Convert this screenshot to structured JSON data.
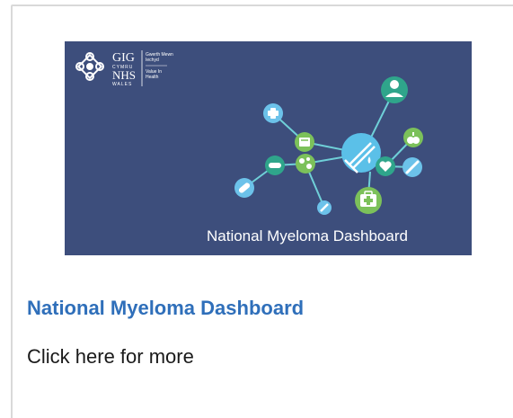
{
  "card": {
    "image": {
      "logo": {
        "gig": "GIG",
        "cymru": "CYMRU",
        "nhs": "NHS",
        "wales": "WALES",
        "line1": "Gwerth Mewn",
        "line2": "Iechyd",
        "line3": "Value In",
        "line4": "Health"
      },
      "caption": "National Myeloma Dashboard",
      "icons": [
        "person-icon",
        "medical-cross-icon",
        "pill-icon",
        "heart-icon",
        "pipette-icon",
        "medical-kit-icon",
        "bandage-icon",
        "syringe-icon",
        "capsule-icon",
        "apple-icon",
        "test-tube-icon"
      ],
      "colors": {
        "background": "#3d4e7c",
        "hub": "#5bc0e8",
        "node_green": "#7cc15a",
        "node_teal": "#2fa58b",
        "node_blue": "#6cc2ea",
        "link": "#6fd0d8"
      }
    },
    "title": "National Myeloma Dashboard",
    "description": "Click here for more",
    "title_color": "#2f6fba"
  }
}
